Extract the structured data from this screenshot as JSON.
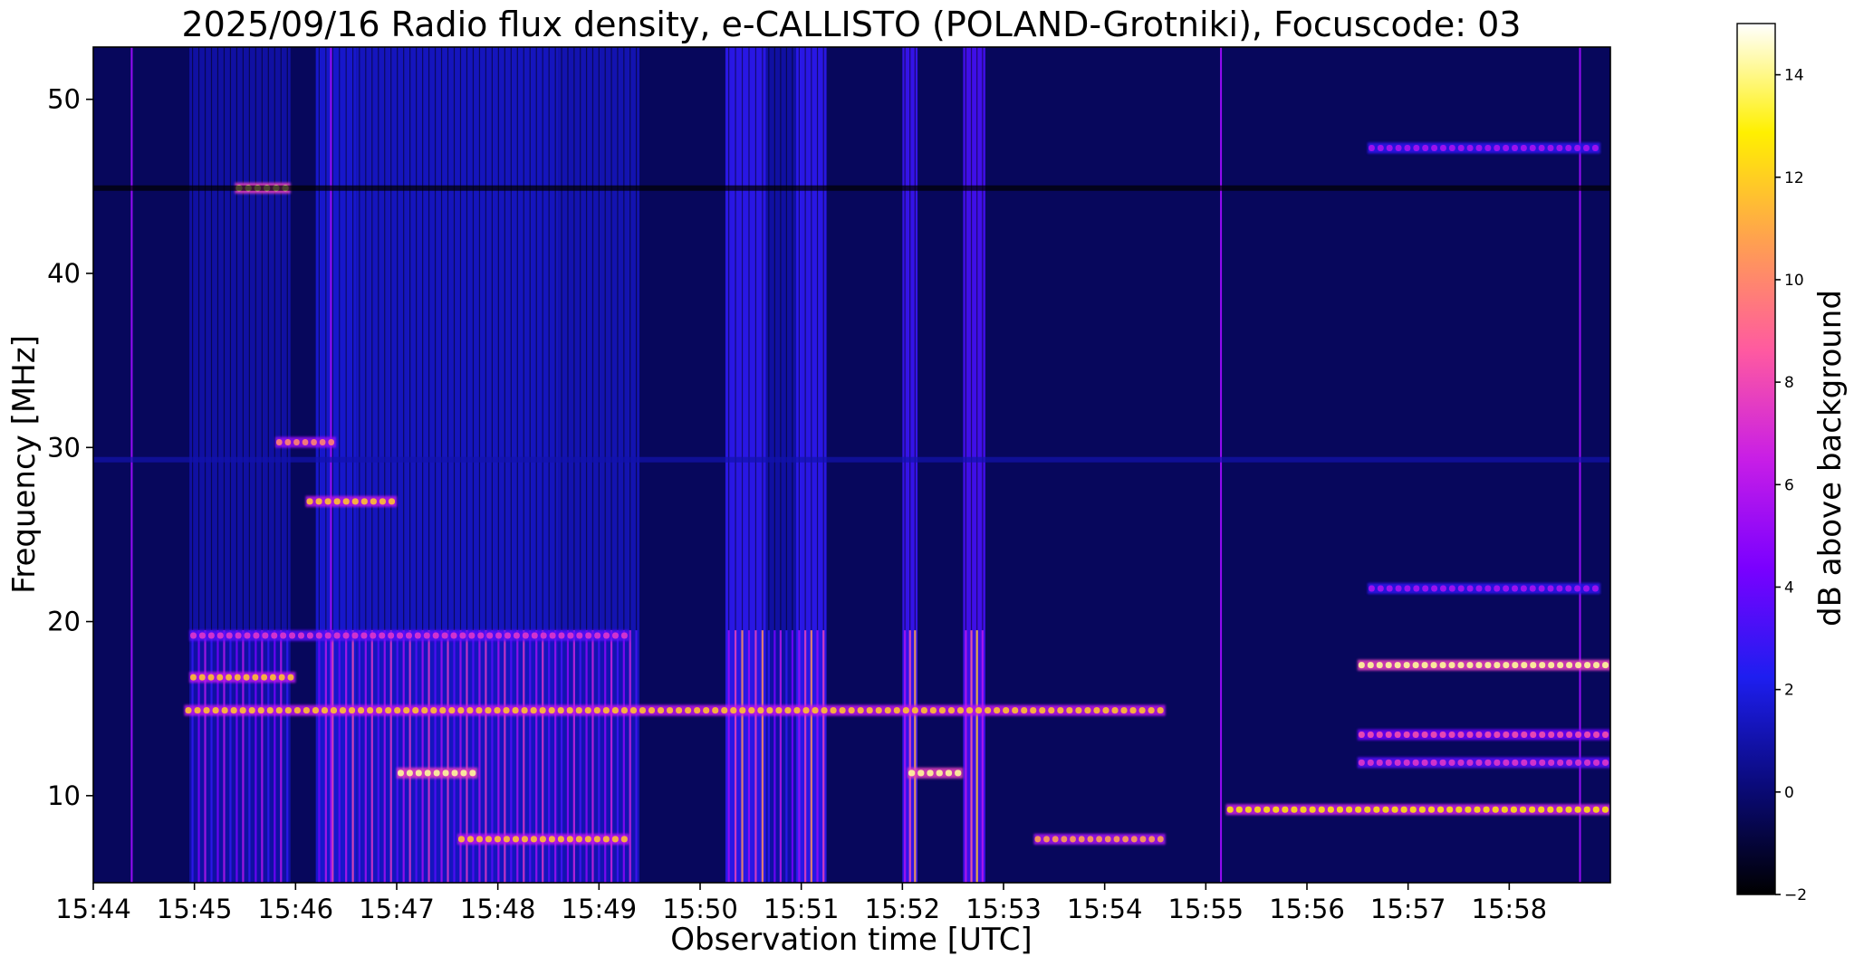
{
  "chart_data": {
    "type": "heatmap",
    "title": "2025/09/16  Radio flux density, e-CALLISTO (POLAND-Grotniki), Focuscode: 03",
    "xlabel": "Observation time [UTC]",
    "ylabel": "Frequency [MHz]",
    "x_ticks": [
      "15:44",
      "15:45",
      "15:46",
      "15:47",
      "15:48",
      "15:49",
      "15:50",
      "15:51",
      "15:52",
      "15:53",
      "15:54",
      "15:55",
      "15:56",
      "15:57",
      "15:58"
    ],
    "y_ticks": [
      10,
      20,
      30,
      40,
      50
    ],
    "xlim_minutes": [
      0,
      15
    ],
    "ylim": [
      5,
      53
    ],
    "colorbar": {
      "label": "dB above background",
      "range": [
        -2,
        15
      ],
      "ticks": [
        -2,
        0,
        2,
        4,
        6,
        8,
        10,
        12,
        14
      ],
      "colormap": "gnuplot2",
      "colormap_stops": [
        "#000000",
        "#0a0a7a",
        "#1e1ef0",
        "#7a00ff",
        "#c81ee6",
        "#ff5aa0",
        "#ffa050",
        "#fff000",
        "#ffffff"
      ]
    },
    "features": {
      "vertical_burst_bands_minutes": [
        {
          "start": 0.95,
          "end": 1.95,
          "intensity": 0.55
        },
        {
          "start": 2.2,
          "end": 2.6,
          "intensity": 0.7
        },
        {
          "start": 2.6,
          "end": 4.6,
          "intensity": 0.65
        },
        {
          "start": 4.6,
          "end": 5.4,
          "intensity": 0.6
        },
        {
          "start": 6.25,
          "end": 6.65,
          "intensity": 0.85
        },
        {
          "start": 6.65,
          "end": 7.0,
          "intensity": 0.55
        },
        {
          "start": 6.95,
          "end": 7.25,
          "intensity": 0.85
        },
        {
          "start": 8.0,
          "end": 8.15,
          "intensity": 0.9
        },
        {
          "start": 8.6,
          "end": 8.82,
          "intensity": 0.95
        }
      ],
      "thin_vertical_lines_minutes": [
        0.38,
        2.35,
        11.15,
        14.7
      ],
      "horizontal_emission_lines": [
        {
          "freq_mhz": 14.9,
          "start": 0.9,
          "end": 10.6,
          "intensity": 0.8
        },
        {
          "freq_mhz": 17.5,
          "start": 12.5,
          "end": 15.0,
          "intensity": 0.95
        },
        {
          "freq_mhz": 16.8,
          "start": 0.95,
          "end": 2.0,
          "intensity": 0.8
        },
        {
          "freq_mhz": 9.2,
          "start": 11.2,
          "end": 15.0,
          "intensity": 0.85
        },
        {
          "freq_mhz": 13.5,
          "start": 12.5,
          "end": 15.0,
          "intensity": 0.6
        },
        {
          "freq_mhz": 11.9,
          "start": 12.5,
          "end": 15.0,
          "intensity": 0.55
        },
        {
          "freq_mhz": 11.3,
          "start": 3.0,
          "end": 3.8,
          "intensity": 0.95
        },
        {
          "freq_mhz": 11.3,
          "start": 8.05,
          "end": 8.6,
          "intensity": 0.95
        },
        {
          "freq_mhz": 7.5,
          "start": 3.6,
          "end": 5.3,
          "intensity": 0.8
        },
        {
          "freq_mhz": 7.5,
          "start": 9.3,
          "end": 10.6,
          "intensity": 0.75
        },
        {
          "freq_mhz": 26.9,
          "start": 2.1,
          "end": 3.0,
          "intensity": 0.8
        },
        {
          "freq_mhz": 30.3,
          "start": 1.8,
          "end": 2.4,
          "intensity": 0.7
        },
        {
          "freq_mhz": 44.9,
          "start": 1.4,
          "end": 1.95,
          "intensity": 0.95
        },
        {
          "freq_mhz": 47.2,
          "start": 12.6,
          "end": 14.9,
          "intensity": 0.45
        },
        {
          "freq_mhz": 21.9,
          "start": 12.6,
          "end": 14.9,
          "intensity": 0.45
        },
        {
          "freq_mhz": 19.2,
          "start": 0.95,
          "end": 5.3,
          "intensity": 0.55
        }
      ]
    }
  }
}
